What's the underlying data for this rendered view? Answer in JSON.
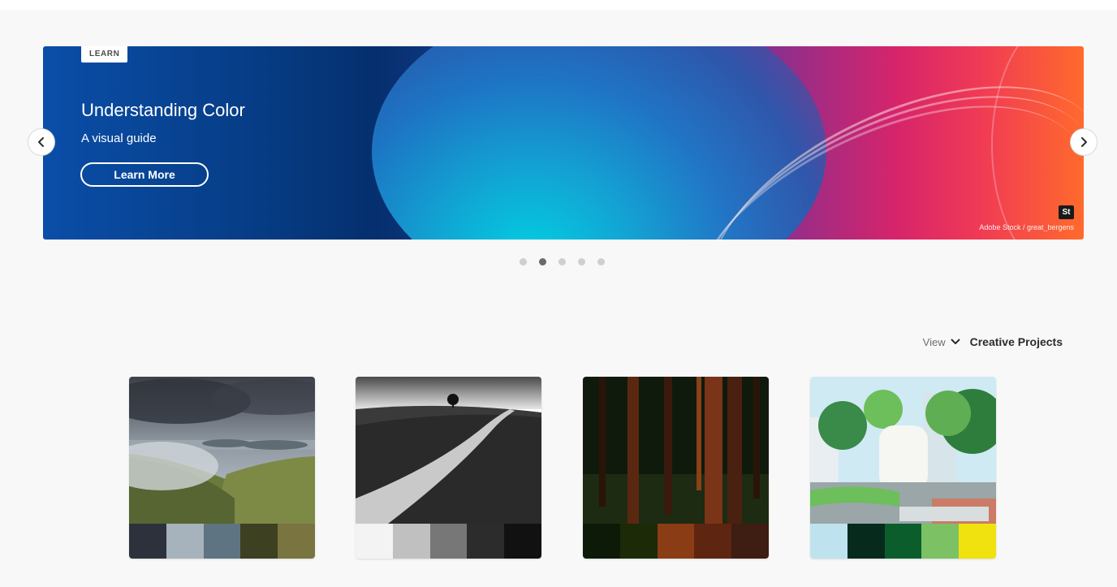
{
  "hero": {
    "tag": "LEARN",
    "title": "Understanding Color",
    "subtitle": "A visual guide",
    "button_label": "Learn More",
    "badge": "St",
    "credit": "Adobe Stock / great_bergens"
  },
  "carousel": {
    "prev_icon": "chevron-left-icon",
    "next_icon": "chevron-right-icon",
    "dots": 5,
    "active_dot": 2
  },
  "view": {
    "label": "View",
    "value": "Creative Projects"
  },
  "themes": [
    {
      "image": "cloudy-hillside-landscape",
      "swatches": [
        "#2d313b",
        "#a6b2bc",
        "#5e7482",
        "#3d4021",
        "#7a7440"
      ]
    },
    {
      "image": "black-white-winding-road",
      "swatches": [
        "#f3f3f3",
        "#c0c0c0",
        "#777777",
        "#2c2c2c",
        "#111111"
      ]
    },
    {
      "image": "dark-forest-trees",
      "swatches": [
        "#0e1a08",
        "#1c2a08",
        "#8a3c14",
        "#5e2510",
        "#3e1d12"
      ]
    },
    {
      "image": "city-park-illustration",
      "swatches": [
        "#bfe3ee",
        "#062a1c",
        "#0b5e2c",
        "#7cc164",
        "#f0e20e"
      ]
    }
  ]
}
